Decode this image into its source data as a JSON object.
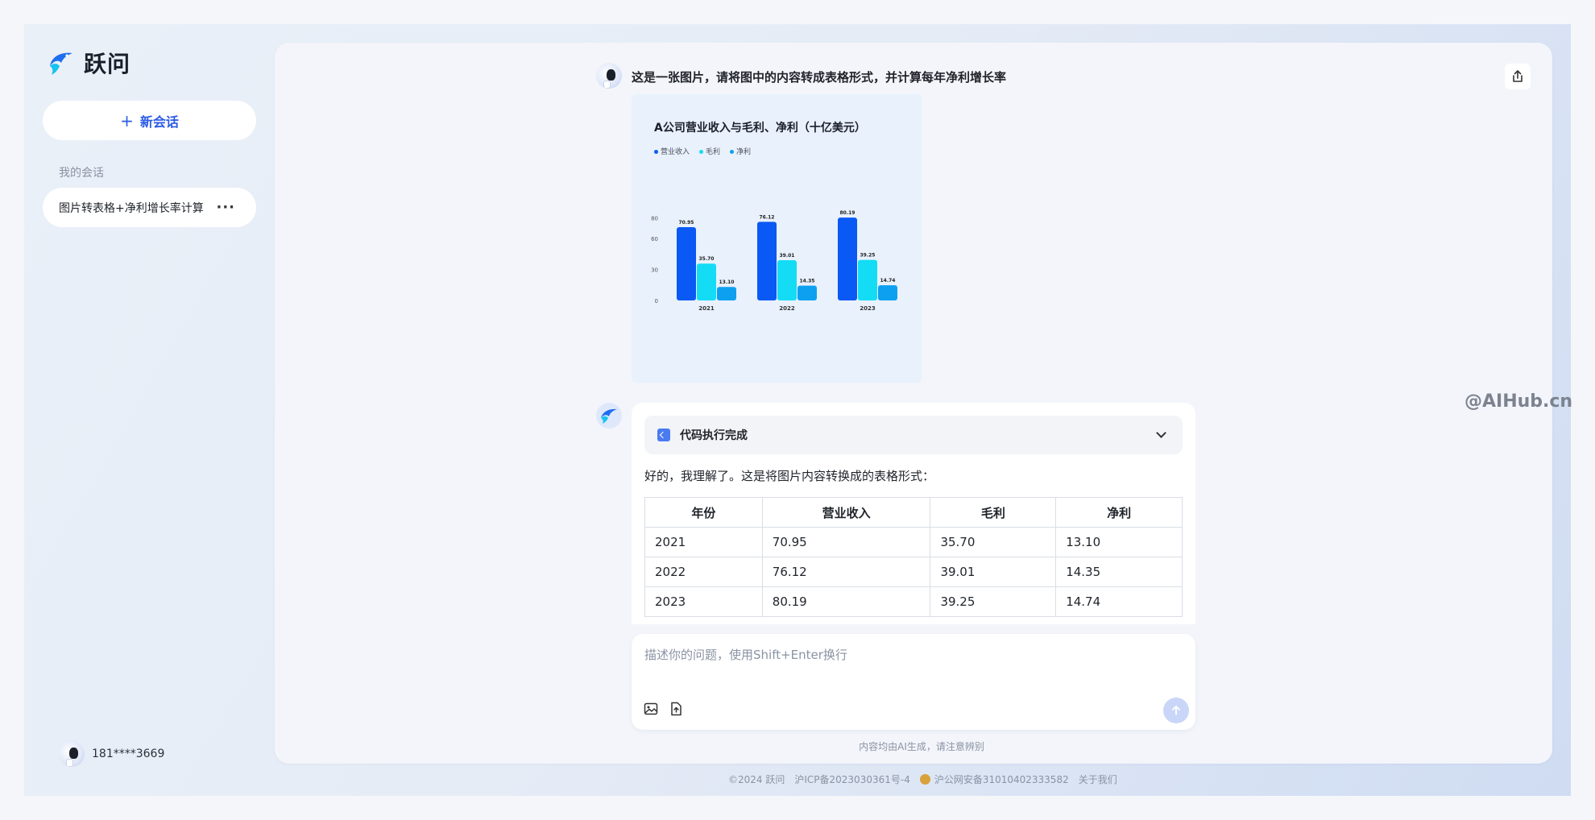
{
  "brand": {
    "name": "跃问"
  },
  "sidebar": {
    "new_chat_label": "新会话",
    "section_label": "我的会话",
    "conversations": [
      {
        "title": "图片转表格+净利增长率计算",
        "more": "···"
      }
    ],
    "user_phone": "181****3669"
  },
  "chat": {
    "user_prompt": "这是一张图片，请将图中的内容转成表格形式，并计算每年净利增长率",
    "code_status": "代码执行完成",
    "answer_intro": "好的，我理解了。这是将图片内容转换成的表格形式：",
    "table": {
      "headers": [
        "年份",
        "营业收入",
        "毛利",
        "净利"
      ],
      "rows": [
        [
          "2021",
          "70.95",
          "35.70",
          "13.10"
        ],
        [
          "2022",
          "76.12",
          "39.01",
          "14.35"
        ],
        [
          "2023",
          "80.19",
          "39.25",
          "14.74"
        ]
      ]
    }
  },
  "input": {
    "placeholder": "描述你的问题，使用Shift+Enter换行",
    "value": ""
  },
  "disclaimer": "内容均由AI生成，请注意辨别",
  "footer": {
    "copyright": "©2024 跃问",
    "icp": "沪ICP备2023030361号-4",
    "police": "沪公网安备31010402333582",
    "about": "关于我们"
  },
  "watermark": "@AIHub.cn",
  "icons": [
    "logo-icon",
    "plus-icon",
    "more-icon",
    "share-icon",
    "code-icon",
    "chevron-down-icon",
    "image-icon",
    "file-upload-icon",
    "send-icon",
    "police-badge-icon"
  ],
  "colors": {
    "accent": "#2a5be6",
    "revenue": "#0a59f5",
    "gross_profit": "#14dcf5",
    "net_profit": "#0ea0f0"
  },
  "chart_data": {
    "type": "bar",
    "title": "A公司营业收入与毛利、净利（十亿美元）",
    "categories": [
      "2021",
      "2022",
      "2023"
    ],
    "series": [
      {
        "name": "营业收入",
        "values": [
          70.95,
          76.12,
          80.19
        ],
        "labels": [
          "70.95",
          "76.12",
          "80.19"
        ]
      },
      {
        "name": "毛利",
        "values": [
          35.7,
          39.01,
          39.25
        ],
        "labels": [
          "35.70",
          "39.01",
          "39.25"
        ]
      },
      {
        "name": "净利",
        "values": [
          13.1,
          14.35,
          14.74
        ],
        "labels": [
          "13.10",
          "14.35",
          "14.74"
        ]
      }
    ],
    "yticks": [
      "0",
      "30",
      "60",
      "80"
    ],
    "ytick_values": [
      0,
      30,
      60,
      80
    ],
    "ylim": [
      0,
      92
    ],
    "legend": "top-left",
    "grid": false
  }
}
